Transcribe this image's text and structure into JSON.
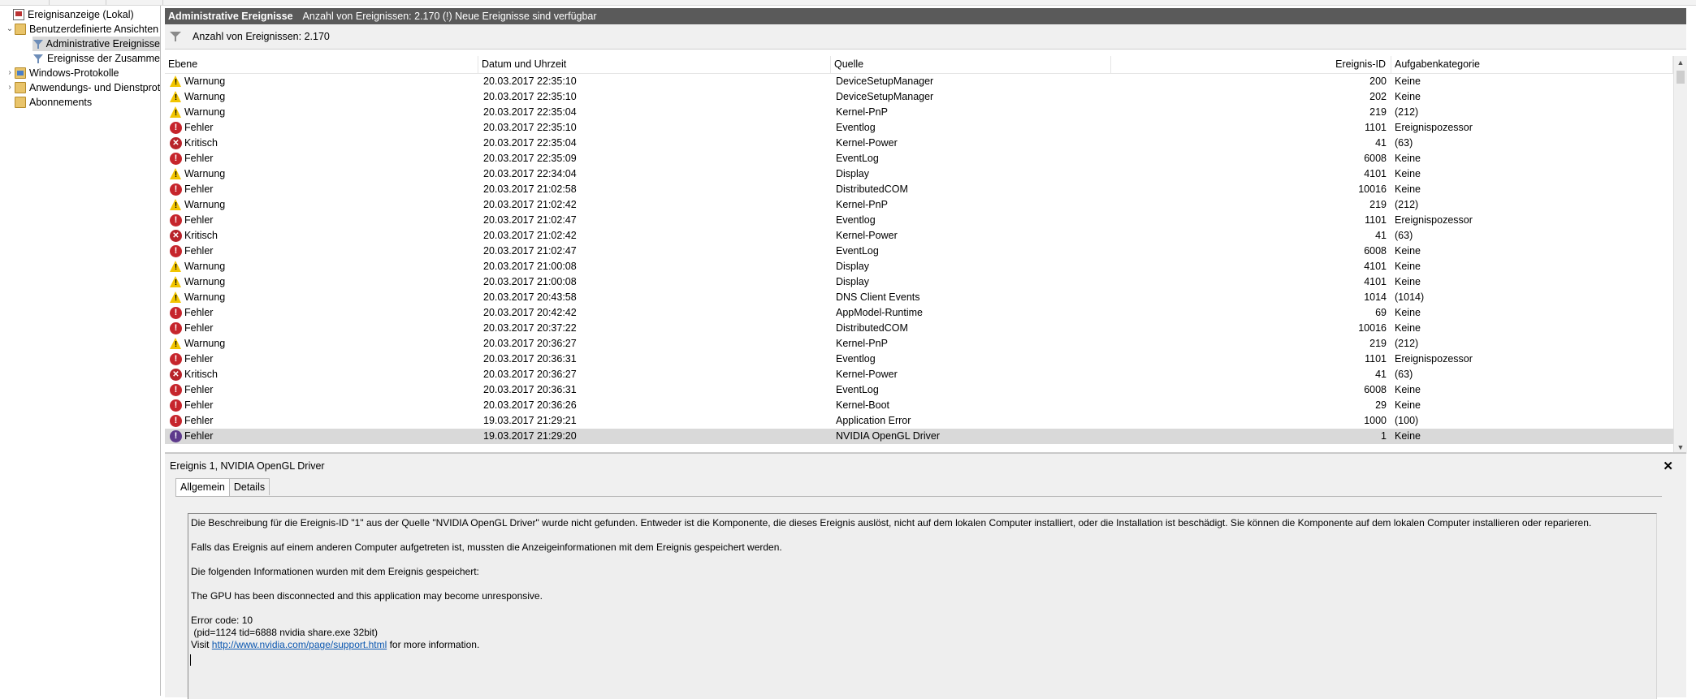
{
  "tree": {
    "items": [
      {
        "label": "Ereignisanzeige (Lokal)",
        "icon": "computer-icon"
      },
      {
        "label": "Benutzerdefinierte Ansichten",
        "icon": "folder-icon",
        "twisty": "expanded"
      },
      {
        "label": "Administrative Ereignisse",
        "icon": "filter-icon"
      },
      {
        "label": "Ereignisse der Zusammenfassungsseite",
        "icon": "filter-icon"
      },
      {
        "label": "Windows-Protokolle",
        "icon": "folder-icon",
        "twisty": "collapsed"
      },
      {
        "label": "Anwendungs- und Dienstprotokolle",
        "icon": "folder-icon",
        "twisty": "collapsed"
      },
      {
        "label": "Abonnements",
        "icon": "folder-icon"
      }
    ]
  },
  "header": {
    "title": "Administrative Ereignisse",
    "info": "Anzahl von Ereignissen: 2.170 (!) Neue Ereignisse sind verfügbar"
  },
  "countbar": {
    "text": "Anzahl von Ereignissen: 2.170"
  },
  "table": {
    "columns": {
      "level": "Ebene",
      "date": "Datum und Uhrzeit",
      "source": "Quelle",
      "id": "Ereignis-ID",
      "category": "Aufgabenkategorie"
    },
    "rows": [
      {
        "type": "warn",
        "level": "Warnung",
        "date": "20.03.2017 22:35:10",
        "source": "DeviceSetupManager",
        "id": "200",
        "category": "Keine"
      },
      {
        "type": "warn",
        "level": "Warnung",
        "date": "20.03.2017 22:35:10",
        "source": "DeviceSetupManager",
        "id": "202",
        "category": "Keine"
      },
      {
        "type": "warn",
        "level": "Warnung",
        "date": "20.03.2017 22:35:04",
        "source": "Kernel-PnP",
        "id": "219",
        "category": "(212)"
      },
      {
        "type": "err",
        "level": "Fehler",
        "date": "20.03.2017 22:35:10",
        "source": "Eventlog",
        "id": "1101",
        "category": "Ereignispozessor"
      },
      {
        "type": "crit",
        "level": "Kritisch",
        "date": "20.03.2017 22:35:04",
        "source": "Kernel-Power",
        "id": "41",
        "category": "(63)"
      },
      {
        "type": "err",
        "level": "Fehler",
        "date": "20.03.2017 22:35:09",
        "source": "EventLog",
        "id": "6008",
        "category": "Keine"
      },
      {
        "type": "warn",
        "level": "Warnung",
        "date": "20.03.2017 22:34:04",
        "source": "Display",
        "id": "4101",
        "category": "Keine"
      },
      {
        "type": "err",
        "level": "Fehler",
        "date": "20.03.2017 21:02:58",
        "source": "DistributedCOM",
        "id": "10016",
        "category": "Keine"
      },
      {
        "type": "warn",
        "level": "Warnung",
        "date": "20.03.2017 21:02:42",
        "source": "Kernel-PnP",
        "id": "219",
        "category": "(212)"
      },
      {
        "type": "err",
        "level": "Fehler",
        "date": "20.03.2017 21:02:47",
        "source": "Eventlog",
        "id": "1101",
        "category": "Ereignispozessor"
      },
      {
        "type": "crit",
        "level": "Kritisch",
        "date": "20.03.2017 21:02:42",
        "source": "Kernel-Power",
        "id": "41",
        "category": "(63)"
      },
      {
        "type": "err",
        "level": "Fehler",
        "date": "20.03.2017 21:02:47",
        "source": "EventLog",
        "id": "6008",
        "category": "Keine"
      },
      {
        "type": "warn",
        "level": "Warnung",
        "date": "20.03.2017 21:00:08",
        "source": "Display",
        "id": "4101",
        "category": "Keine"
      },
      {
        "type": "warn",
        "level": "Warnung",
        "date": "20.03.2017 21:00:08",
        "source": "Display",
        "id": "4101",
        "category": "Keine"
      },
      {
        "type": "warn",
        "level": "Warnung",
        "date": "20.03.2017 20:43:58",
        "source": "DNS Client Events",
        "id": "1014",
        "category": "(1014)"
      },
      {
        "type": "err",
        "level": "Fehler",
        "date": "20.03.2017 20:42:42",
        "source": "AppModel-Runtime",
        "id": "69",
        "category": "Keine"
      },
      {
        "type": "err",
        "level": "Fehler",
        "date": "20.03.2017 20:37:22",
        "source": "DistributedCOM",
        "id": "10016",
        "category": "Keine"
      },
      {
        "type": "warn",
        "level": "Warnung",
        "date": "20.03.2017 20:36:27",
        "source": "Kernel-PnP",
        "id": "219",
        "category": "(212)"
      },
      {
        "type": "err",
        "level": "Fehler",
        "date": "20.03.2017 20:36:31",
        "source": "Eventlog",
        "id": "1101",
        "category": "Ereignispozessor"
      },
      {
        "type": "crit",
        "level": "Kritisch",
        "date": "20.03.2017 20:36:27",
        "source": "Kernel-Power",
        "id": "41",
        "category": "(63)"
      },
      {
        "type": "err",
        "level": "Fehler",
        "date": "20.03.2017 20:36:31",
        "source": "EventLog",
        "id": "6008",
        "category": "Keine"
      },
      {
        "type": "err",
        "level": "Fehler",
        "date": "20.03.2017 20:36:26",
        "source": "Kernel-Boot",
        "id": "29",
        "category": "Keine"
      },
      {
        "type": "err",
        "level": "Fehler",
        "date": "19.03.2017 21:29:21",
        "source": "Application Error",
        "id": "1000",
        "category": "(100)"
      },
      {
        "type": "err",
        "level": "Fehler",
        "date": "19.03.2017 21:29:20",
        "source": "NVIDIA OpenGL Driver",
        "id": "1",
        "category": "Keine",
        "selected": true
      }
    ]
  },
  "details": {
    "title": "Ereignis 1, NVIDIA OpenGL Driver",
    "tabs": [
      "Allgemein",
      "Details"
    ],
    "lines": {
      "l1": "Die Beschreibung für die Ereignis-ID \"1\" aus der Quelle \"NVIDIA OpenGL Driver\" wurde nicht gefunden. Entweder ist die Komponente, die dieses Ereignis auslöst, nicht auf dem lokalen Computer installiert, oder die Installation ist beschädigt. Sie können die Komponente auf dem lokalen Computer installieren oder reparieren.",
      "l2": "Falls das Ereignis auf einem anderen Computer aufgetreten ist, mussten die Anzeigeinformationen mit dem Ereignis gespeichert werden.",
      "l3": "Die folgenden Informationen wurden mit dem Ereignis gespeichert:",
      "l4": "The GPU has been disconnected and this application may become unresponsive.",
      "l5": "Error code: 10",
      "l6": " (pid=1124 tid=6888 nvidia share.exe 32bit)",
      "visit": "Visit ",
      "link": "http://www.nvidia.com/page/support.html",
      "after": " for more information."
    }
  }
}
